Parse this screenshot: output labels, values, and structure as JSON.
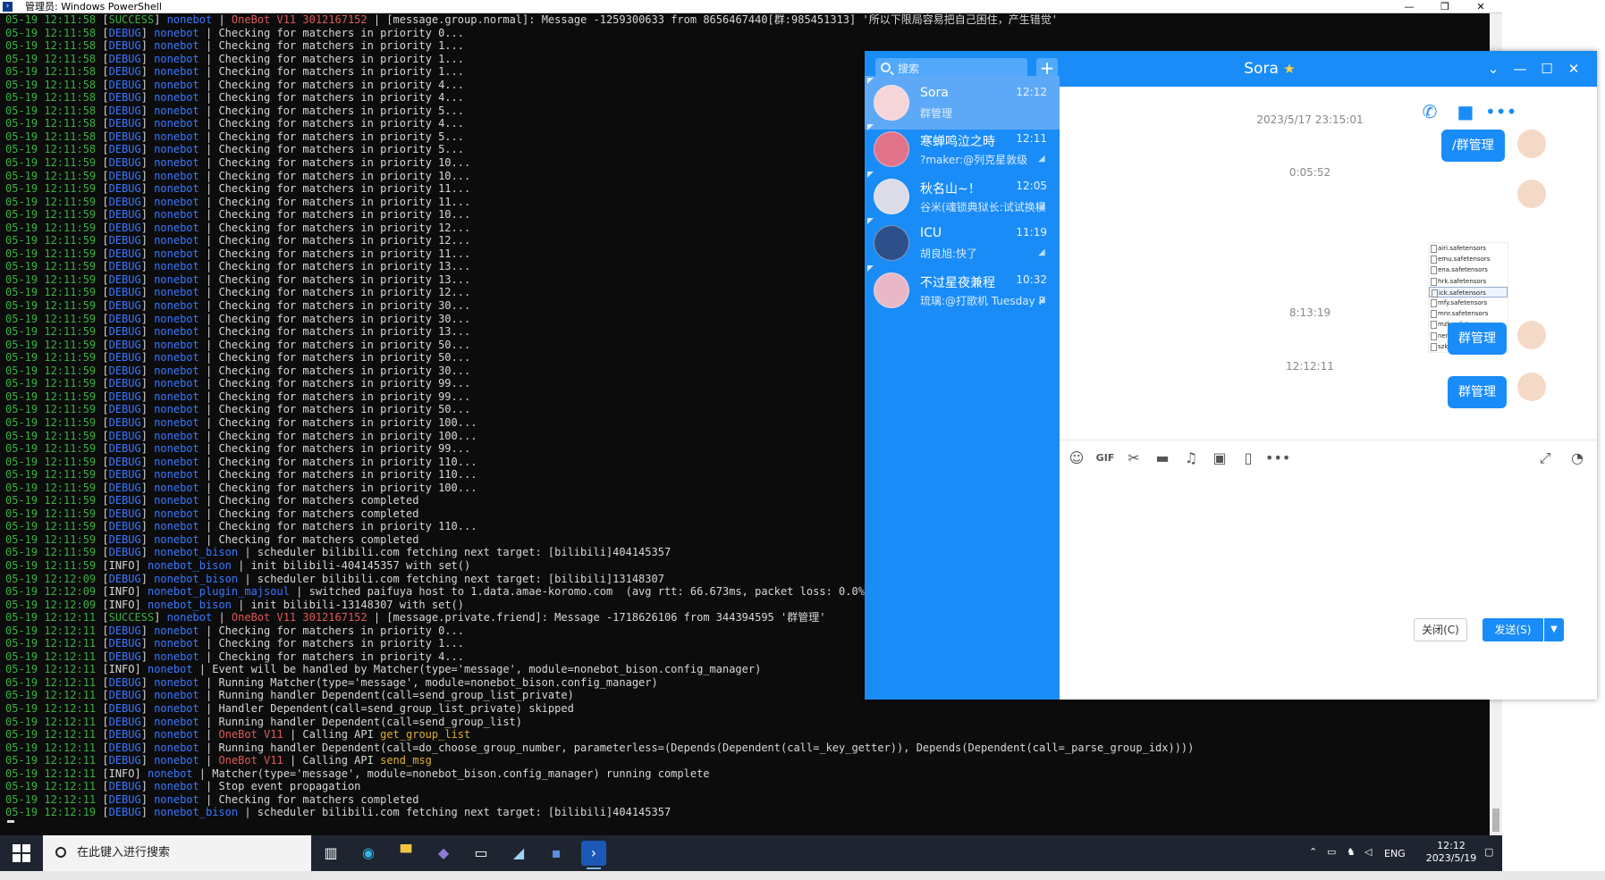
{
  "powershell": {
    "title": "管理员: Windows PowerShell",
    "lines": [
      {
        "t": "05-19 12:11:58",
        "lv": "SUCCESS",
        "mod": "nonebot",
        "ob": "OneBot V11 3012167152",
        "msg": "| [message.group.normal]: Message -1259300633 from 8656467440[群:985451313] '所以下限局容易把自己困住，产生错觉'"
      },
      {
        "t": "05-19 12:11:58",
        "lv": "DEBUG",
        "mod": "nonebot",
        "msg": "| Checking for matchers in priority 0..."
      },
      {
        "t": "05-19 12:11:58",
        "lv": "DEBUG",
        "mod": "nonebot",
        "msg": "| Checking for matchers in priority 1..."
      },
      {
        "t": "05-19 12:11:58",
        "lv": "DEBUG",
        "mod": "nonebot",
        "msg": "| Checking for matchers in priority 1..."
      },
      {
        "t": "05-19 12:11:58",
        "lv": "DEBUG",
        "mod": "nonebot",
        "msg": "| Checking for matchers in priority 1..."
      },
      {
        "t": "05-19 12:11:58",
        "lv": "DEBUG",
        "mod": "nonebot",
        "msg": "| Checking for matchers in priority 4..."
      },
      {
        "t": "05-19 12:11:58",
        "lv": "DEBUG",
        "mod": "nonebot",
        "msg": "| Checking for matchers in priority 4..."
      },
      {
        "t": "05-19 12:11:58",
        "lv": "DEBUG",
        "mod": "nonebot",
        "msg": "| Checking for matchers in priority 5..."
      },
      {
        "t": "05-19 12:11:58",
        "lv": "DEBUG",
        "mod": "nonebot",
        "msg": "| Checking for matchers in priority 4..."
      },
      {
        "t": "05-19 12:11:58",
        "lv": "DEBUG",
        "mod": "nonebot",
        "msg": "| Checking for matchers in priority 5..."
      },
      {
        "t": "05-19 12:11:58",
        "lv": "DEBUG",
        "mod": "nonebot",
        "msg": "| Checking for matchers in priority 5..."
      },
      {
        "t": "05-19 12:11:59",
        "lv": "DEBUG",
        "mod": "nonebot",
        "msg": "| Checking for matchers in priority 10..."
      },
      {
        "t": "05-19 12:11:59",
        "lv": "DEBUG",
        "mod": "nonebot",
        "msg": "| Checking for matchers in priority 10..."
      },
      {
        "t": "05-19 12:11:59",
        "lv": "DEBUG",
        "mod": "nonebot",
        "msg": "| Checking for matchers in priority 11..."
      },
      {
        "t": "05-19 12:11:59",
        "lv": "DEBUG",
        "mod": "nonebot",
        "msg": "| Checking for matchers in priority 11..."
      },
      {
        "t": "05-19 12:11:59",
        "lv": "DEBUG",
        "mod": "nonebot",
        "msg": "| Checking for matchers in priority 10..."
      },
      {
        "t": "05-19 12:11:59",
        "lv": "DEBUG",
        "mod": "nonebot",
        "msg": "| Checking for matchers in priority 12..."
      },
      {
        "t": "05-19 12:11:59",
        "lv": "DEBUG",
        "mod": "nonebot",
        "msg": "| Checking for matchers in priority 12..."
      },
      {
        "t": "05-19 12:11:59",
        "lv": "DEBUG",
        "mod": "nonebot",
        "msg": "| Checking for matchers in priority 11..."
      },
      {
        "t": "05-19 12:11:59",
        "lv": "DEBUG",
        "mod": "nonebot",
        "msg": "| Checking for matchers in priority 13..."
      },
      {
        "t": "05-19 12:11:59",
        "lv": "DEBUG",
        "mod": "nonebot",
        "msg": "| Checking for matchers in priority 13..."
      },
      {
        "t": "05-19 12:11:59",
        "lv": "DEBUG",
        "mod": "nonebot",
        "msg": "| Checking for matchers in priority 12..."
      },
      {
        "t": "05-19 12:11:59",
        "lv": "DEBUG",
        "mod": "nonebot",
        "msg": "| Checking for matchers in priority 30..."
      },
      {
        "t": "05-19 12:11:59",
        "lv": "DEBUG",
        "mod": "nonebot",
        "msg": "| Checking for matchers in priority 30..."
      },
      {
        "t": "05-19 12:11:59",
        "lv": "DEBUG",
        "mod": "nonebot",
        "msg": "| Checking for matchers in priority 13..."
      },
      {
        "t": "05-19 12:11:59",
        "lv": "DEBUG",
        "mod": "nonebot",
        "msg": "| Checking for matchers in priority 50..."
      },
      {
        "t": "05-19 12:11:59",
        "lv": "DEBUG",
        "mod": "nonebot",
        "msg": "| Checking for matchers in priority 50..."
      },
      {
        "t": "05-19 12:11:59",
        "lv": "DEBUG",
        "mod": "nonebot",
        "msg": "| Checking for matchers in priority 30..."
      },
      {
        "t": "05-19 12:11:59",
        "lv": "DEBUG",
        "mod": "nonebot",
        "msg": "| Checking for matchers in priority 99..."
      },
      {
        "t": "05-19 12:11:59",
        "lv": "DEBUG",
        "mod": "nonebot",
        "msg": "| Checking for matchers in priority 99..."
      },
      {
        "t": "05-19 12:11:59",
        "lv": "DEBUG",
        "mod": "nonebot",
        "msg": "| Checking for matchers in priority 50..."
      },
      {
        "t": "05-19 12:11:59",
        "lv": "DEBUG",
        "mod": "nonebot",
        "msg": "| Checking for matchers in priority 100..."
      },
      {
        "t": "05-19 12:11:59",
        "lv": "DEBUG",
        "mod": "nonebot",
        "msg": "| Checking for matchers in priority 100..."
      },
      {
        "t": "05-19 12:11:59",
        "lv": "DEBUG",
        "mod": "nonebot",
        "msg": "| Checking for matchers in priority 99..."
      },
      {
        "t": "05-19 12:11:59",
        "lv": "DEBUG",
        "mod": "nonebot",
        "msg": "| Checking for matchers in priority 110..."
      },
      {
        "t": "05-19 12:11:59",
        "lv": "DEBUG",
        "mod": "nonebot",
        "msg": "| Checking for matchers in priority 110..."
      },
      {
        "t": "05-19 12:11:59",
        "lv": "DEBUG",
        "mod": "nonebot",
        "msg": "| Checking for matchers in priority 100..."
      },
      {
        "t": "05-19 12:11:59",
        "lv": "DEBUG",
        "mod": "nonebot",
        "msg": "| Checking for matchers completed"
      },
      {
        "t": "05-19 12:11:59",
        "lv": "DEBUG",
        "mod": "nonebot",
        "msg": "| Checking for matchers completed"
      },
      {
        "t": "05-19 12:11:59",
        "lv": "DEBUG",
        "mod": "nonebot",
        "msg": "| Checking for matchers in priority 110..."
      },
      {
        "t": "05-19 12:11:59",
        "lv": "DEBUG",
        "mod": "nonebot",
        "msg": "| Checking for matchers completed"
      },
      {
        "t": "05-19 12:11:59",
        "lv": "DEBUG",
        "mod": "nonebot_bison",
        "msg": "| scheduler bilibili.com fetching next target: [bilibili]404145357"
      },
      {
        "t": "05-19 12:11:59",
        "lv": "INFO",
        "mod": "nonebot_bison",
        "msg": "| init bilibili-404145357 with set()"
      },
      {
        "t": "05-19 12:12:09",
        "lv": "DEBUG",
        "mod": "nonebot_bison",
        "msg": "| scheduler bilibili.com fetching next target: [bilibili]13148307"
      },
      {
        "t": "05-19 12:12:09",
        "lv": "INFO",
        "mod": "nonebot_plugin_majsoul",
        "msg": "| switched paifuya host to 1.data.amae-koromo.com  (avg rtt: 66.673ms, packet loss: 0.0%)"
      },
      {
        "t": "05-19 12:12:09",
        "lv": "INFO",
        "mod": "nonebot_bison",
        "msg": "| init bilibili-13148307 with set()"
      },
      {
        "t": "05-19 12:12:11",
        "lv": "SUCCESS",
        "mod": "nonebot",
        "ob": "OneBot V11 3012167152",
        "msg": "| [message.private.friend]: Message -1718626106 from 344394595 '群管理'"
      },
      {
        "t": "05-19 12:12:11",
        "lv": "DEBUG",
        "mod": "nonebot",
        "msg": "| Checking for matchers in priority 0..."
      },
      {
        "t": "05-19 12:12:11",
        "lv": "DEBUG",
        "mod": "nonebot",
        "msg": "| Checking for matchers in priority 1..."
      },
      {
        "t": "05-19 12:12:11",
        "lv": "DEBUG",
        "mod": "nonebot",
        "msg": "| Checking for matchers in priority 4..."
      },
      {
        "t": "05-19 12:12:11",
        "lv": "INFO",
        "mod": "nonebot",
        "msg": "| Event will be handled by Matcher(type='message', module=nonebot_bison.config_manager)"
      },
      {
        "t": "05-19 12:12:11",
        "lv": "DEBUG",
        "mod": "nonebot",
        "msg": "| Running Matcher(type='message', module=nonebot_bison.config_manager)"
      },
      {
        "t": "05-19 12:12:11",
        "lv": "DEBUG",
        "mod": "nonebot",
        "msg": "| Running handler Dependent(call=send_group_list_private)"
      },
      {
        "t": "05-19 12:12:11",
        "lv": "DEBUG",
        "mod": "nonebot",
        "msg": "| Handler Dependent(call=send_group_list_private) skipped"
      },
      {
        "t": "05-19 12:12:11",
        "lv": "DEBUG",
        "mod": "nonebot",
        "msg": "| Running handler Dependent(call=send_group_list)"
      },
      {
        "t": "05-19 12:12:11",
        "lv": "DEBUG",
        "mod": "nonebot",
        "ob": "OneBot V11",
        "api": "get_group_list",
        "msg": "| Calling API "
      },
      {
        "t": "05-19 12:12:11",
        "lv": "DEBUG",
        "mod": "nonebot",
        "msg": "| Running handler Dependent(call=do_choose_group_number, parameterless=(Depends(Dependent(call=_key_getter)), Depends(Dependent(call=_parse_group_idx))))"
      },
      {
        "t": "05-19 12:12:11",
        "lv": "DEBUG",
        "mod": "nonebot",
        "ob": "OneBot V11",
        "api": "send_msg",
        "msg": "| Calling API "
      },
      {
        "t": "05-19 12:12:11",
        "lv": "INFO",
        "mod": "nonebot",
        "msg": "| Matcher(type='message', module=nonebot_bison.config_manager) running complete"
      },
      {
        "t": "05-19 12:12:11",
        "lv": "DEBUG",
        "mod": "nonebot",
        "msg": "| Stop event propagation"
      },
      {
        "t": "05-19 12:12:11",
        "lv": "DEBUG",
        "mod": "nonebot",
        "msg": "| Checking for matchers completed"
      },
      {
        "t": "05-19 12:12:19",
        "lv": "DEBUG",
        "mod": "nonebot_bison",
        "msg": "| scheduler bilibili.com fetching next target: [bilibili]404145357"
      }
    ]
  },
  "qq": {
    "search_placeholder": "搜索",
    "add_label": "+",
    "chat_title": "Sora",
    "star": "★",
    "conversations": [
      {
        "name": "Sora",
        "time": "12:12",
        "preview": "群管理",
        "color": "#f6d5d8",
        "active": true
      },
      {
        "name": "寒蝉鸣泣之時",
        "time": "12:11",
        "preview": "?maker:@列克星敦级",
        "color": "#e0738a",
        "active": false
      },
      {
        "name": "秋名山~！",
        "time": "12:05",
        "preview": "谷米(魂锁典狱长:试试换模",
        "color": "#dcdce8",
        "active": false
      },
      {
        "name": "ICU",
        "time": "11:19",
        "preview": "胡良旭:快了",
        "color": "#2d4f8a",
        "active": false
      },
      {
        "name": "不过星夜兼程",
        "time": "10:32",
        "preview": "琉璃:@打歌机 Tuesday P",
        "color": "#e9b8c8",
        "active": false
      }
    ],
    "messages": {
      "ts1": "2023/5/17 23:15:01",
      "msg1": "/群管理",
      "ts2": "0:05:52",
      "files": [
        "airi.safetensors",
        "emu.safetensors",
        "ena.safetensors",
        "hrk.safetensors",
        "ick.safetensors",
        "mfy.safetensors",
        "mnr.safetensors",
        "mzk.safetensors",
        "nene.safetensors",
        "szk.safetensors"
      ],
      "ts3": "8:13:19",
      "msg2": "群管理",
      "ts4": "12:12:11",
      "msg3": "群管理"
    },
    "close_label": "关闭(C)",
    "send_label": "发送(S)"
  },
  "taskbar": {
    "search_placeholder": "在此键入进行搜索",
    "lang": "ENG",
    "time": "12:12",
    "date": "2023/5/19"
  },
  "colors": {
    "qq_blue": "#1a8cf7",
    "console_bg": "#0c0c0c",
    "debug": "#3b78ff",
    "success": "#3cb043"
  }
}
